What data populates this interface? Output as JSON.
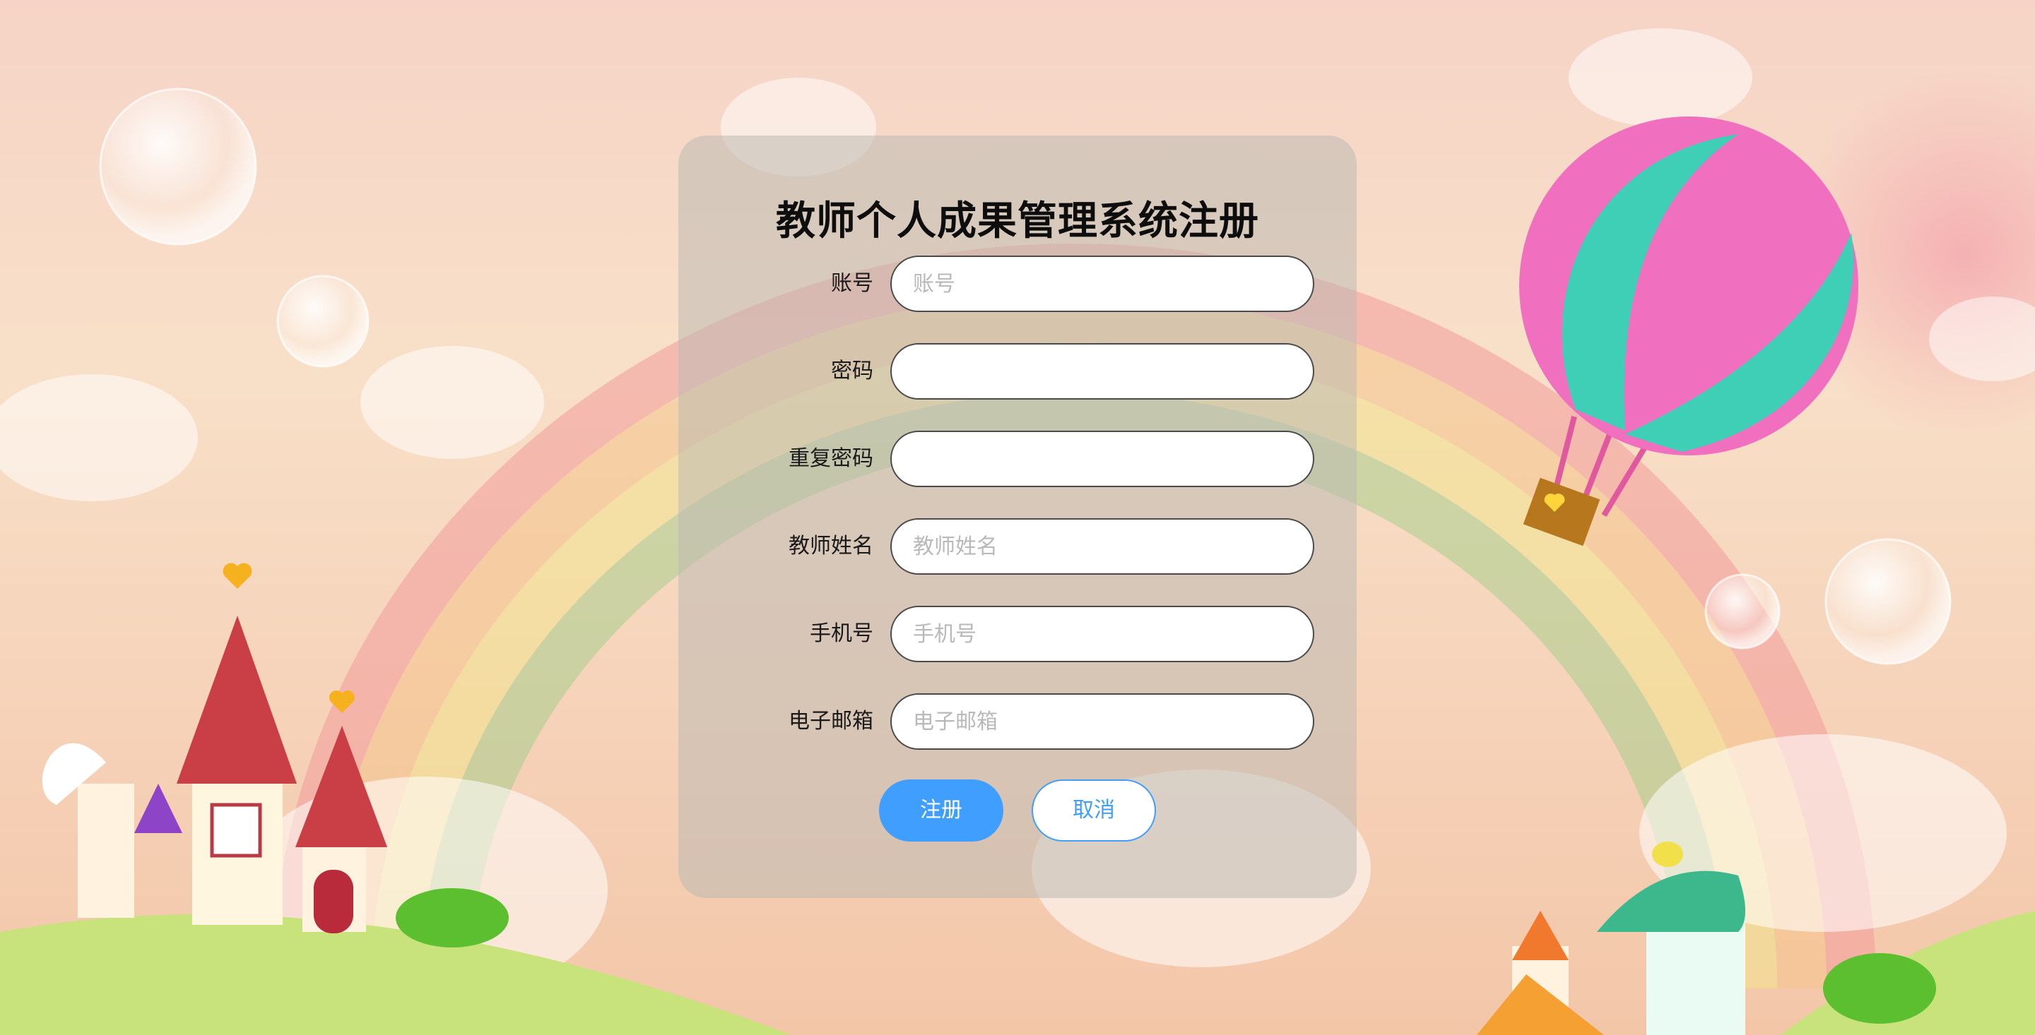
{
  "page": {
    "title": "教师个人成果管理系统注册"
  },
  "form": {
    "fields": [
      {
        "label": "账号",
        "placeholder": "账号",
        "value": ""
      },
      {
        "label": "密码",
        "placeholder": "",
        "value": ""
      },
      {
        "label": "重复密码",
        "placeholder": "",
        "value": ""
      },
      {
        "label": "教师姓名",
        "placeholder": "教师姓名",
        "value": ""
      },
      {
        "label": "手机号",
        "placeholder": "手机号",
        "value": ""
      },
      {
        "label": "电子邮箱",
        "placeholder": "电子邮箱",
        "value": ""
      }
    ],
    "register_label": "注册",
    "cancel_label": "取消"
  },
  "colors": {
    "primary": "#409eff",
    "card": "#c0bcb2"
  }
}
